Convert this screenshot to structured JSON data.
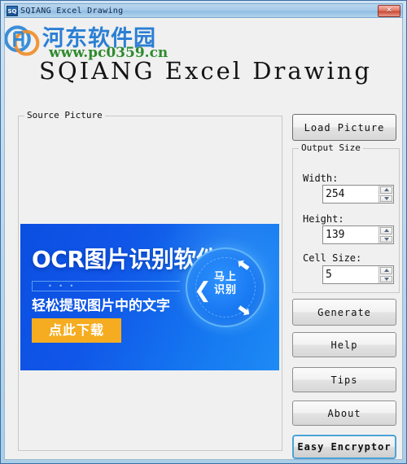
{
  "window": {
    "title": "SQIANG Excel Drawing",
    "title_icon": "sq-app-icon",
    "close_label": "✕"
  },
  "watermark": {
    "site_name": "河东软件园",
    "url": "www.pc0359.cn"
  },
  "heading": "SQIANG Excel Drawing",
  "source_picture": {
    "group_label": "Source Picture",
    "banner": {
      "title": "OCR图片识别软件",
      "subtitle": "轻松提取图片中的文字",
      "cta_label": "点此下载",
      "badge_line1": "马上",
      "badge_line2": "识别",
      "divider_dots": "• • •",
      "arrow_left": "❮",
      "arrow_top_right": "⬅",
      "arrow_bottom_right": "⬅",
      "bg_color": "#1056e8",
      "cta_color": "#f5ac20"
    }
  },
  "panel": {
    "load_picture_label": "Load Picture",
    "output_size": {
      "group_label": "Output Size",
      "width_label": "Width:",
      "width_value": "254",
      "height_label": "Height:",
      "height_value": "139",
      "cell_size_label": "Cell Size:",
      "cell_size_value": "5"
    },
    "generate_label": "Generate",
    "help_label": "Help",
    "tips_label": "Tips",
    "about_label": "About",
    "easy_encryptor_label": "Easy Encryptor",
    "focus_color": "#4aa3d8"
  }
}
